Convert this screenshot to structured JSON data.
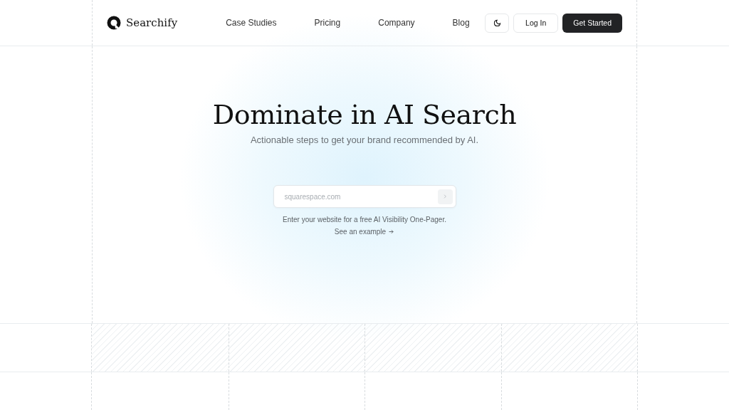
{
  "brand": {
    "name": "Searchify"
  },
  "nav": {
    "links": [
      "Case Studies",
      "Pricing",
      "Company",
      "Blog"
    ]
  },
  "actions": {
    "login": "Log In",
    "cta": "Get Started"
  },
  "hero": {
    "title": "Dominate in AI Search",
    "subtitle": "Actionable steps to get your brand recommended by AI.",
    "input": {
      "placeholder": "squarespace.com"
    },
    "hint": "Enter your website for a free AI Visibility One-Pager.",
    "example_link": "See an example"
  }
}
